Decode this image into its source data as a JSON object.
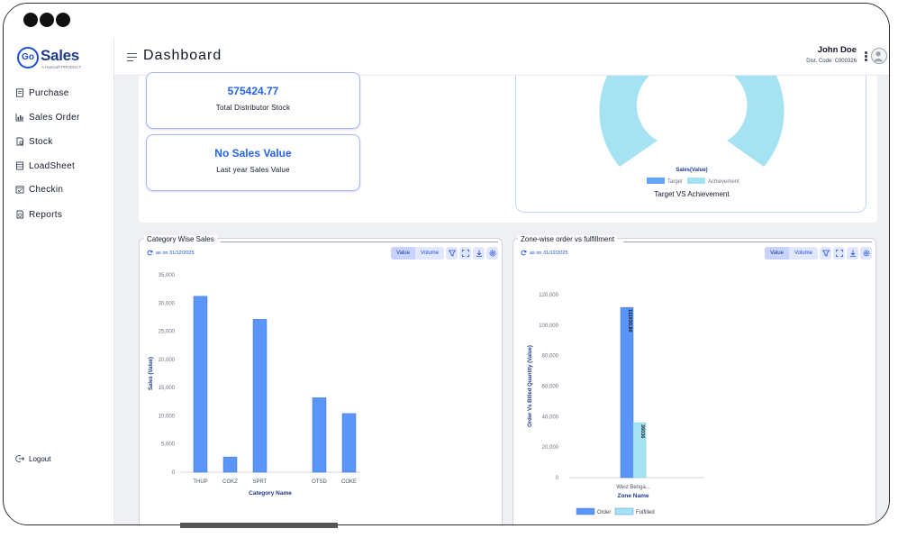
{
  "window": {
    "controls": [
      "close",
      "minimize",
      "maximize"
    ]
  },
  "brand": {
    "logo_mark": "Go",
    "name": "Sales",
    "tagline": "A Hamsoft PRODUCT"
  },
  "sidebar": {
    "items": [
      {
        "label": "Purchase",
        "icon": "document-icon"
      },
      {
        "label": "Sales Order",
        "icon": "bar-chart-icon"
      },
      {
        "label": "Stock",
        "icon": "stock-icon"
      },
      {
        "label": "LoadSheet",
        "icon": "sheet-icon"
      },
      {
        "label": "Checkin",
        "icon": "calendar-check-icon"
      },
      {
        "label": "Reports",
        "icon": "reports-icon"
      }
    ],
    "logout_label": "Logout"
  },
  "header": {
    "title": "Dashboard",
    "user_name": "John Doe",
    "dist_code": "Dist. Code: C000326"
  },
  "stats": [
    {
      "value": "575424.77",
      "label": "Total Distributor Stock"
    },
    {
      "value": "No Sales Value",
      "label": "Last year Sales Value"
    }
  ],
  "donut": {
    "legend_title": "Sales(Value)",
    "legend": [
      {
        "name": "Target",
        "color": "#60a5fa"
      },
      {
        "name": "Achievement",
        "color": "#a5e3f2"
      }
    ],
    "caption": "Target VS Achievement"
  },
  "colors": {
    "accent": "#2563eb",
    "bar_primary": "#5b95f7",
    "bar_secondary": "#a5e3f2"
  },
  "panels": {
    "category": {
      "title": "Category Wise Sales",
      "as_on": "as on 31/12/2025",
      "toggle": [
        "Value",
        "Volume"
      ],
      "active": "Value"
    },
    "zone": {
      "title": "Zone-wise order vs fulfillment",
      "as_on": "as on 31/12/2025",
      "toggle": [
        "Value",
        "Volume"
      ],
      "active": "Value"
    }
  },
  "chart_data": [
    {
      "type": "bar",
      "title": "Category Wise Sales",
      "categories": [
        "THUP",
        "COKZ",
        "SPRT",
        "",
        "OTSD",
        "COKE"
      ],
      "values": [
        31200,
        2700,
        27100,
        0,
        13200,
        10400
      ],
      "xlabel": "Category Name",
      "ylabel": "Sales (Value)",
      "yticks": [
        "35,000",
        "30,000",
        "25,000",
        "20,000",
        "15,000",
        "10,000",
        "5,000",
        "0"
      ],
      "ylim": [
        0,
        35000
      ],
      "grid": false,
      "legend": "none"
    },
    {
      "type": "bar",
      "title": "Zone-wise order vs fulfillment",
      "categories": [
        "West Benga..."
      ],
      "series": [
        {
          "name": "Order",
          "values": [
            111630.86
          ],
          "label": "111630.86"
        },
        {
          "name": "Fulfilled",
          "values": [
            36036
          ],
          "label": "36036"
        }
      ],
      "xlabel": "Zone Name",
      "ylabel": "Order Vs Billed Quantity (Value)",
      "yticks": [
        "120,000",
        "100,000",
        "80,000",
        "60,000",
        "40,000",
        "20,000",
        "0"
      ],
      "ylim": [
        0,
        120000
      ],
      "grid": false,
      "legend": "bottom"
    }
  ]
}
